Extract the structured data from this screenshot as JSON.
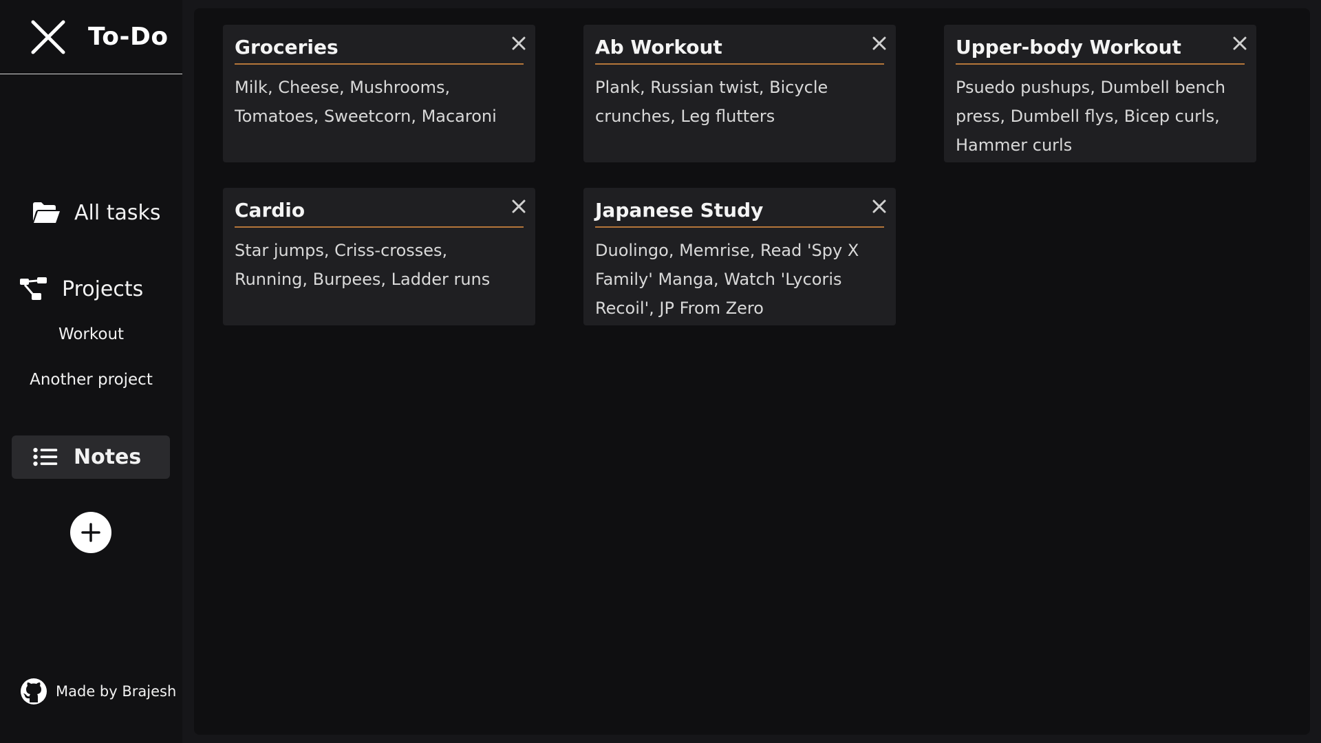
{
  "app": {
    "title": "To-Do"
  },
  "sidebar": {
    "all_tasks_label": "All tasks",
    "projects_label": "Projects",
    "projects": [
      {
        "label": "Workout"
      },
      {
        "label": "Another project"
      }
    ],
    "notes_label": "Notes",
    "footer_label": "Made by Brajesh"
  },
  "notes": [
    {
      "title": "Groceries",
      "body": "Milk, Cheese, Mushrooms, Tomatoes, Sweetcorn, Macaroni"
    },
    {
      "title": "Ab Workout",
      "body": "Plank, Russian twist, Bicycle crunches, Leg flutters"
    },
    {
      "title": "Upper-body Workout",
      "body": "Psuedo pushups, Dumbell bench press, Dumbell flys, Bicep curls, Hammer curls"
    },
    {
      "title": "Cardio",
      "body": "Star jumps, Criss-crosses, Running, Burpees, Ladder runs"
    },
    {
      "title": "Japanese Study",
      "body": "Duolingo, Memrise, Read 'Spy X Family' Manga, Watch 'Lycoris Recoil', JP From Zero"
    }
  ],
  "icons": {
    "brand": "close-x-icon",
    "all_tasks": "folder-open-icon",
    "projects": "sitemap-icon",
    "notes": "list-icon",
    "add": "plus-icon",
    "footer": "github-icon",
    "card_close": "close-icon"
  },
  "colors": {
    "accent_underline": "#b5763a",
    "sidebar_bg": "#111113",
    "main_bg": "#0f0f11",
    "card_bg": "#1f1f22",
    "active_nav_bg": "#2a2a2d"
  }
}
